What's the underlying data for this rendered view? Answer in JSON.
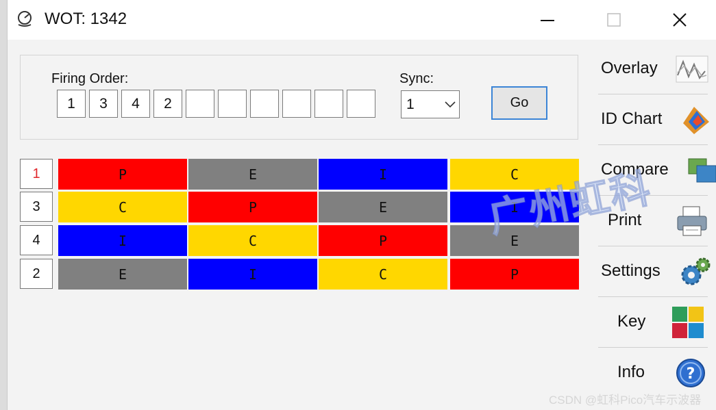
{
  "window": {
    "title": "WOT: 1342",
    "icon": "gauge-icon",
    "controls": {
      "minimize": "minimize-icon",
      "maximize": "maximize-icon",
      "close": "close-icon"
    }
  },
  "firing_order": {
    "label": "Firing Order:",
    "values": [
      "1",
      "3",
      "4",
      "2",
      "",
      "",
      "",
      "",
      "",
      ""
    ]
  },
  "sync": {
    "label": "Sync:",
    "value": "1"
  },
  "go_label": "Go",
  "strokes": {
    "colors": {
      "P": "#ff0000",
      "E": "#808080",
      "I": "#0000ff",
      "C": "#ffd700"
    }
  },
  "grid": {
    "rows": [
      {
        "cylinder": "1",
        "active": true,
        "cells": [
          "P",
          "E",
          "I",
          "C"
        ]
      },
      {
        "cylinder": "3",
        "active": false,
        "cells": [
          "C",
          "P",
          "E",
          "I"
        ]
      },
      {
        "cylinder": "4",
        "active": false,
        "cells": [
          "I",
          "C",
          "P",
          "E"
        ]
      },
      {
        "cylinder": "2",
        "active": false,
        "cells": [
          "E",
          "I",
          "C",
          "P"
        ]
      }
    ]
  },
  "sidebar": {
    "items": [
      {
        "label": "Overlay",
        "icon": "overlay-waveform-icon"
      },
      {
        "label": "ID Chart",
        "icon": "id-chart-icon"
      },
      {
        "label": "Compare",
        "icon": "compare-icon"
      },
      {
        "label": "Print",
        "icon": "printer-icon"
      },
      {
        "label": "Settings",
        "icon": "gears-icon"
      },
      {
        "label": "Key",
        "icon": "color-key-icon"
      },
      {
        "label": "Info",
        "icon": "info-icon"
      }
    ]
  },
  "watermark": "广州虹科",
  "footer_credit": "CSDN @虹科Pico汽车示波器"
}
